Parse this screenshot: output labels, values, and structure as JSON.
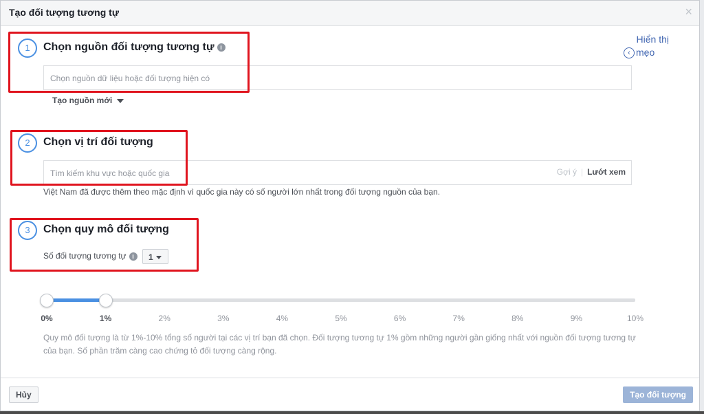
{
  "dialog": {
    "title": "Tạo đối tượng tương tự",
    "close_glyph": "×"
  },
  "tips": {
    "line1": "Hiển thị",
    "line2": "mẹo",
    "icon": "chevron-left-circle-icon"
  },
  "step1": {
    "number": "1",
    "title": "Chọn nguồn đối tượng tương tự",
    "placeholder": "Chọn nguồn dữ liệu hoặc đối tượng hiện có",
    "create_new": "Tạo nguồn mới"
  },
  "step2": {
    "number": "2",
    "title": "Chọn vị trí đối tượng",
    "placeholder": "Tìm kiếm khu vực hoặc quốc gia",
    "suggest": "Gợi ý",
    "browse": "Lướt xem",
    "hint": "Việt Nam đã được thêm theo mặc định vì quốc gia này có số người lớn nhất trong đối tượng nguồn của bạn."
  },
  "step3": {
    "number": "3",
    "title": "Chọn quy mô đối tượng",
    "count_label": "Số đối tượng tương tự",
    "count_value": "1"
  },
  "slider": {
    "ticks": [
      "0%",
      "1%",
      "2%",
      "3%",
      "4%",
      "5%",
      "6%",
      "7%",
      "8%",
      "9%",
      "10%"
    ],
    "range_start_percent": 0,
    "range_end_percent": 1
  },
  "description": "Quy mô đối tượng là từ 1%-10% tổng số người tại các vị trí bạn đã chọn. Đối tượng tương tự 1% gồm những người gần giống nhất với nguồn đối tượng tương tự của bạn. Số phần trăm càng cao chứng tỏ đối tượng càng rộng.",
  "footer": {
    "cancel": "Hủy",
    "create": "Tạo đối tượng"
  },
  "colors": {
    "accent": "#4a90e2",
    "highlight_box": "#e0141e",
    "disabled_button": "#9cb4d8"
  }
}
